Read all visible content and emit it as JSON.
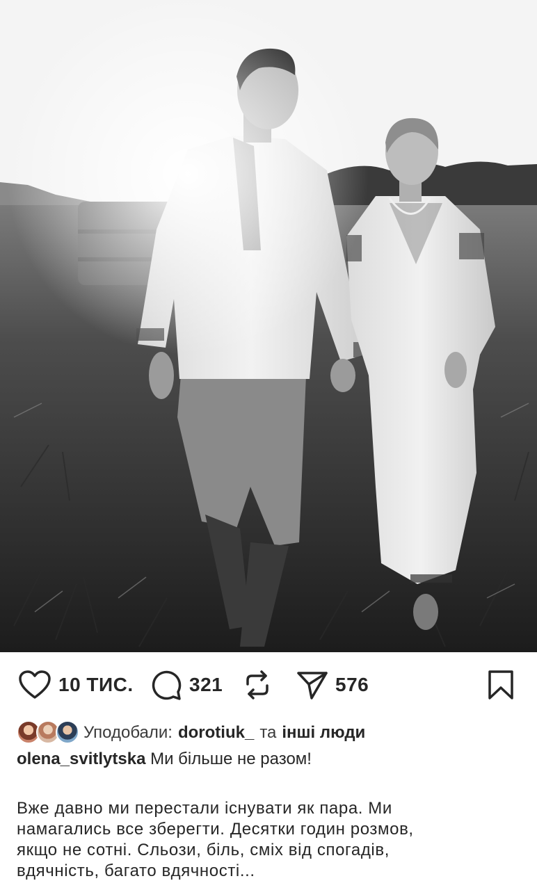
{
  "photo": {
    "alt_subject": "post-photo"
  },
  "actions": {
    "likes_count": "10 ТИС.",
    "comments_count": "321",
    "shares_count": "576"
  },
  "liked_by": {
    "prefix": "Уподобали:",
    "user": "dorotiuk_",
    "conjunction": "та",
    "others": "інші люди"
  },
  "caption": {
    "username": "olena_svitlytska",
    "headline": "Ми більше не разом!",
    "lines": [
      "Вже давно ми перестали існувати як пара. Ми",
      "намагались все зберегти. Десятки годин розмов,",
      "якщо не сотні. Сльози, біль, сміх від спогадів,",
      "вдячність, багато вдячності..."
    ]
  },
  "colors": {
    "text": "#262626",
    "background": "#ffffff"
  }
}
